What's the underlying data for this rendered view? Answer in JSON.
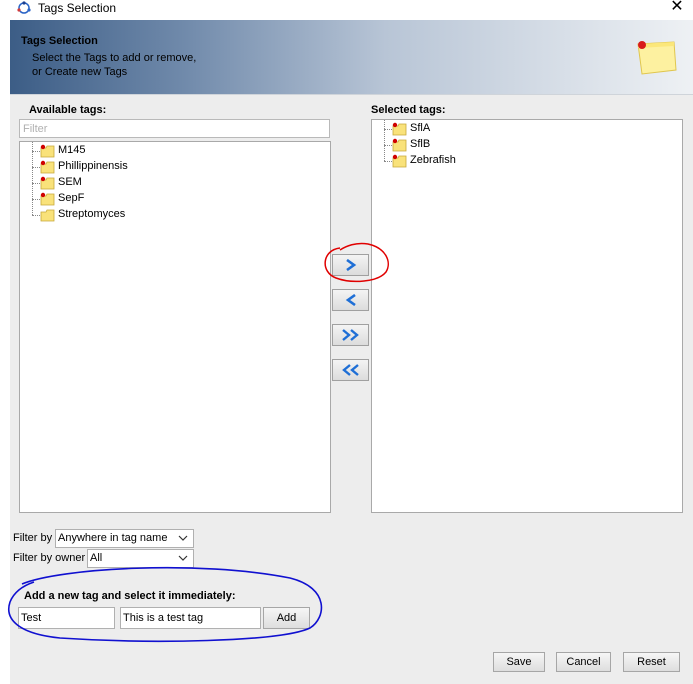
{
  "window": {
    "title": "Tags Selection"
  },
  "header": {
    "title": "Tags Selection",
    "description_line1": "Select the Tags to add or remove,",
    "description_line2": "or Create new Tags"
  },
  "available": {
    "label": "Available tags:",
    "filter_placeholder": "Filter",
    "items": [
      "M145",
      "Phillippinensis",
      "SEM",
      "SepF",
      "Streptomyces"
    ]
  },
  "selected": {
    "label": "Selected tags:",
    "items": [
      "SflA",
      "SflB",
      "Zebrafish"
    ]
  },
  "move_buttons": {
    "add_selected": "add-selected-arrow",
    "remove_selected": "remove-selected-arrow",
    "add_all": "add-all-arrows",
    "remove_all": "remove-all-arrows"
  },
  "filters": {
    "filter_by_label": "Filter by",
    "filter_by_value": "Anywhere in tag name",
    "owner_label": "Filter by owner",
    "owner_value": "All"
  },
  "new_tag": {
    "label": "Add a new tag and select it immediately:",
    "name_value": "Test",
    "description_value": "This is a test tag",
    "add_button": "Add"
  },
  "footer": {
    "save": "Save",
    "cancel": "Cancel",
    "reset": "Reset"
  },
  "colors": {
    "annotation_red": "#e00000",
    "annotation_blue": "#1010d0",
    "arrow_blue": "#1f6fd6",
    "folder_yellow": "#f9e27a",
    "tag_red_dot": "#d00000"
  }
}
